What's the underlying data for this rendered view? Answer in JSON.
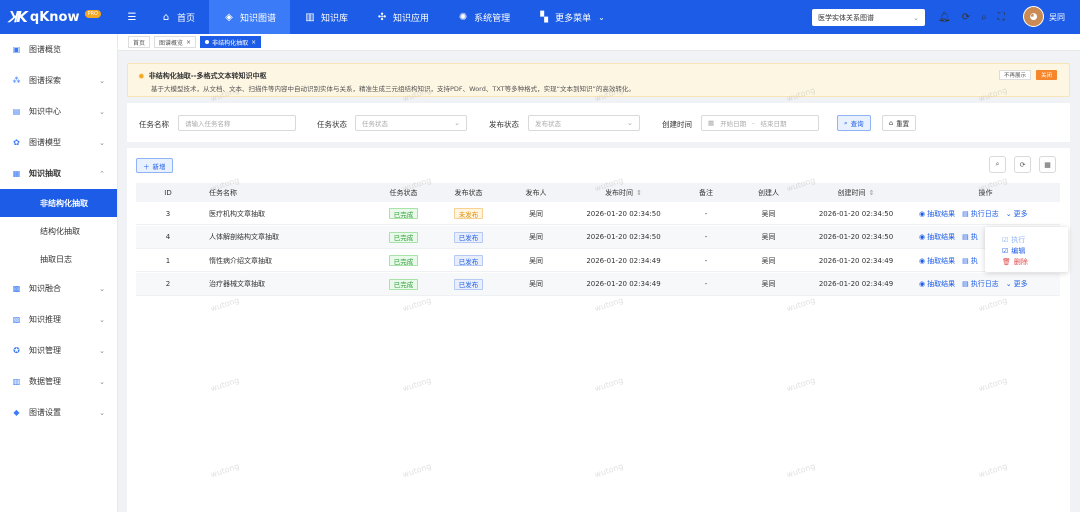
{
  "brand": {
    "name": "qKnow",
    "badge": "PRO"
  },
  "nav": {
    "items": [
      {
        "label": "首页",
        "icon": "home-icon",
        "glyph": "⌂"
      },
      {
        "label": "知识图谱",
        "icon": "graph-icon",
        "glyph": "◈"
      },
      {
        "label": "知识库",
        "icon": "library-icon",
        "glyph": "▥"
      },
      {
        "label": "知识应用",
        "icon": "apps-icon",
        "glyph": "✣"
      },
      {
        "label": "系统管理",
        "icon": "settings-icon",
        "glyph": "✺"
      },
      {
        "label": "更多菜单",
        "icon": "more-grid-icon",
        "glyph": "▚"
      }
    ],
    "active_index": 1
  },
  "graph_selector": {
    "value": "医学实体关系图谱"
  },
  "user": {
    "name": "吴同"
  },
  "sidebar": {
    "items": [
      {
        "label": "图谱概览",
        "glyph": "▣",
        "has_children": false
      },
      {
        "label": "图谱探索",
        "glyph": "⁂",
        "has_children": true
      },
      {
        "label": "知识中心",
        "glyph": "▤",
        "has_children": true
      },
      {
        "label": "图谱模型",
        "glyph": "✿",
        "has_children": true
      },
      {
        "label": "知识抽取",
        "glyph": "▦",
        "has_children": true,
        "expanded": true
      },
      {
        "label": "知识融合",
        "glyph": "▩",
        "has_children": true
      },
      {
        "label": "知识推理",
        "glyph": "▧",
        "has_children": true
      },
      {
        "label": "知识管理",
        "glyph": "✪",
        "has_children": true
      },
      {
        "label": "数据管理",
        "glyph": "▥",
        "has_children": true
      },
      {
        "label": "图谱设置",
        "glyph": "◆",
        "has_children": true
      }
    ],
    "sub_items": [
      "非结构化抽取",
      "结构化抽取",
      "抽取日志"
    ],
    "active_sub": "非结构化抽取"
  },
  "tabs": [
    {
      "label": "首页",
      "closable": false
    },
    {
      "label": "图谱概览",
      "closable": true
    },
    {
      "label": "非结构化抽取",
      "closable": true,
      "active": true
    }
  ],
  "notice": {
    "title": "非结构化抽取--多格式文本转知识中枢",
    "description": "基于大模型技术，从文档、文本、扫描件等内容中自动识别实体与关系，精准生成三元组结构知识，支持PDF、Word、TXT等多种格式，实现“文本到知识”的高效转化。",
    "no_more_label": "不再展示",
    "close_label": "关闭"
  },
  "search": {
    "task_name_label": "任务名称",
    "task_name_placeholder": "请输入任务名称",
    "task_status_label": "任务状态",
    "task_status_placeholder": "任务状态",
    "publish_status_label": "发布状态",
    "publish_status_placeholder": "发布状态",
    "created_label": "创建时间",
    "start_placeholder": "开始日期",
    "end_placeholder": "结束日期",
    "date_separator": "-",
    "query_label": "查询",
    "reset_label": "重置"
  },
  "toolbar": {
    "add_label": "新增"
  },
  "table": {
    "headers": [
      "ID",
      "任务名称",
      "任务状态",
      "发布状态",
      "发布人",
      "发布时间",
      "备注",
      "创建人",
      "创建时间",
      "操作"
    ],
    "sort_glyph": "⇕",
    "rows": [
      {
        "id": "3",
        "name": "医疗机构文章抽取",
        "task_status": "已完成",
        "task_status_color": "green",
        "publish_status": "未发布",
        "publish_status_color": "orange",
        "publisher": "吴同",
        "publish_time": "2026-01-20 02:34:50",
        "remark": "-",
        "creator": "吴同",
        "created": "2026-01-20 02:34:50"
      },
      {
        "id": "4",
        "name": "人体解剖结构文章抽取",
        "task_status": "已完成",
        "task_status_color": "green",
        "publish_status": "已发布",
        "publish_status_color": "blue",
        "publisher": "吴同",
        "publish_time": "2026-01-20 02:34:50",
        "remark": "-",
        "creator": "吴同",
        "created": "2026-01-20 02:34:50"
      },
      {
        "id": "1",
        "name": "惰性病介绍文章抽取",
        "task_status": "已完成",
        "task_status_color": "green",
        "publish_status": "已发布",
        "publish_status_color": "blue",
        "publisher": "吴同",
        "publish_time": "2026-01-20 02:34:49",
        "remark": "-",
        "creator": "吴同",
        "created": "2026-01-20 02:34:49"
      },
      {
        "id": "2",
        "name": "治疗器械文章抽取",
        "task_status": "已完成",
        "task_status_color": "green",
        "publish_status": "已发布",
        "publish_status_color": "blue",
        "publisher": "吴同",
        "publish_time": "2026-01-20 02:34:49",
        "remark": "-",
        "creator": "吴同",
        "created": "2026-01-20 02:34:49"
      }
    ],
    "actions": {
      "result_label": "抽取结果",
      "log_label": "执行日志",
      "log_label_truncated": "执",
      "more_label": "更多"
    }
  },
  "more_menu": {
    "items": [
      {
        "label": "执行",
        "color": "#8fb3f5"
      },
      {
        "label": "编辑",
        "color": "#1d5ce6"
      },
      {
        "label": "删除",
        "color": "#e24b4b"
      }
    ]
  },
  "watermark": "wutong",
  "colors": {
    "primary": "#1d5ce6",
    "success": "#2e9d3a",
    "warning": "#e08c00",
    "danger": "#e24b4b"
  }
}
